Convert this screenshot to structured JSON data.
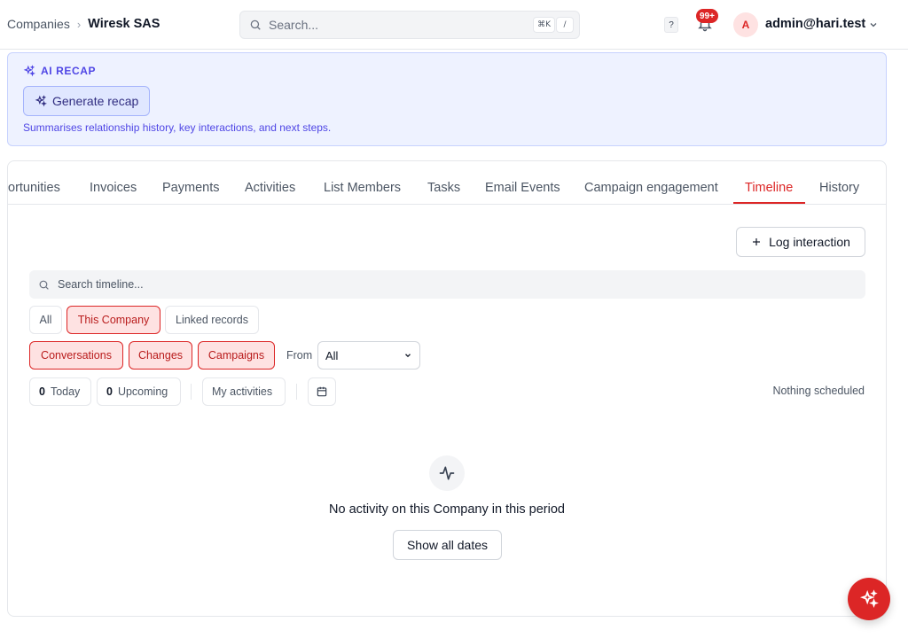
{
  "breadcrumb": {
    "parent": "Companies",
    "current": "Wiresk SAS"
  },
  "search": {
    "placeholder": "Search...",
    "kbd_shortcut": "⌘K",
    "kbd_slash": "/"
  },
  "header": {
    "help_label": "?",
    "notification_count": "99+",
    "avatar_initial": "A",
    "user_email": "admin@hari.test"
  },
  "ai_recap": {
    "title": "AI RECAP",
    "button_label": "Generate recap",
    "description": "Summarises relationship history, key interactions, and next steps."
  },
  "tabs": [
    {
      "label": "ortunities"
    },
    {
      "label": "Invoices"
    },
    {
      "label": "Payments"
    },
    {
      "label": "Activities"
    },
    {
      "label": "List Members"
    },
    {
      "label": "Tasks"
    },
    {
      "label": "Email Events"
    },
    {
      "label": "Campaign engagement"
    },
    {
      "label": "Timeline",
      "active": true
    },
    {
      "label": "History"
    }
  ],
  "timeline": {
    "log_button": "Log interaction",
    "search_placeholder": "Search timeline...",
    "scope_filters": [
      "All",
      "This Company",
      "Linked records"
    ],
    "type_filters": [
      "Conversations",
      "Changes",
      "Campaigns"
    ],
    "from_label": "From",
    "from_value": "All",
    "stats": {
      "today_count": "0",
      "today_label": "Today",
      "upcoming_count": "0",
      "upcoming_label": "Upcoming",
      "my_activities": "My activities"
    },
    "nothing_scheduled": "Nothing scheduled",
    "empty_message": "No activity on this Company in this period",
    "show_all_button": "Show all dates"
  },
  "colors": {
    "accent": "#dc2626",
    "ai": "#4f46e5",
    "ai_bg": "#eef2ff"
  }
}
